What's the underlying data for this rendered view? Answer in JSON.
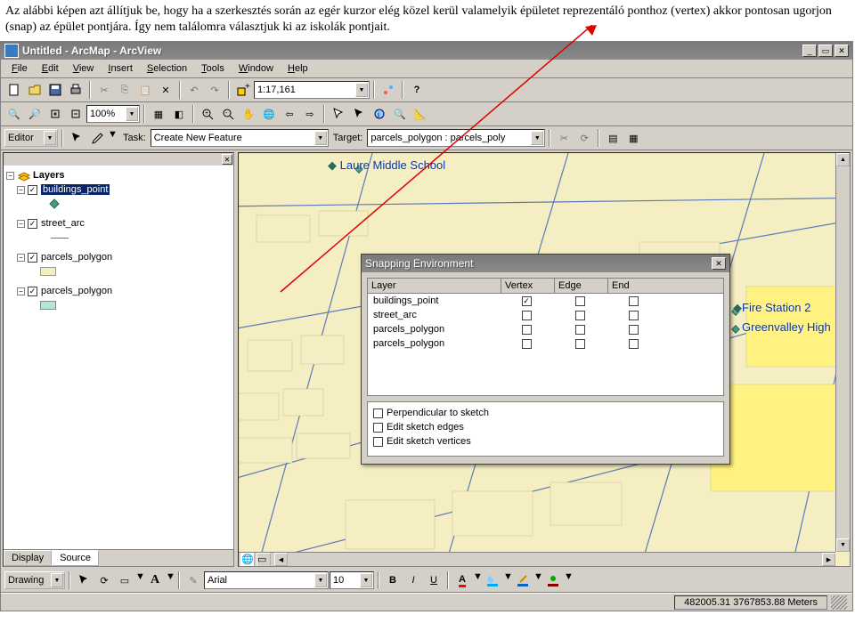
{
  "caption": "Az alábbi képen azt állítjuk be, hogy ha a szerkesztés során az egér kurzor elég közel kerül valamelyik épületet reprezentáló ponthoz (vertex) akkor pontosan ugorjon (snap) az épület pontjára. Így nem találomra választjuk ki az iskolák pontjait.",
  "window_title": "Untitled - ArcMap - ArcView",
  "menus": [
    "File",
    "Edit",
    "View",
    "Insert",
    "Selection",
    "Tools",
    "Window",
    "Help"
  ],
  "scale": "1:17,161",
  "zoom_pct": "100%",
  "editor_label": "Editor",
  "task_label": "Task:",
  "task_value": "Create New Feature",
  "target_label": "Target:",
  "target_value": "parcels_polygon : parcels_poly",
  "toc_header": "Layers",
  "layers": [
    {
      "name": "buildings_point",
      "selected": true
    },
    {
      "name": "street_arc",
      "selected": false
    },
    {
      "name": "parcels_polygon",
      "selected": false
    },
    {
      "name": "parcels_polygon",
      "selected": false
    }
  ],
  "toc_tabs": {
    "display": "Display",
    "source": "Source"
  },
  "map_labels": {
    "laure": "Laure  Middle  School",
    "fire": "Fire Station 2",
    "green": "Greenvalley High"
  },
  "snap": {
    "title": "Snapping Environment",
    "cols": [
      "Layer",
      "Vertex",
      "Edge",
      "End"
    ],
    "rows": [
      "buildings_point",
      "street_arc",
      "parcels_polygon",
      "parcels_polygon"
    ],
    "opts": [
      "Perpendicular to sketch",
      "Edit sketch edges",
      "Edit sketch vertices"
    ]
  },
  "drawing_label": "Drawing",
  "font_name": "Arial",
  "font_size": "10",
  "status_coords": "482005.31 3767853.88 Meters"
}
